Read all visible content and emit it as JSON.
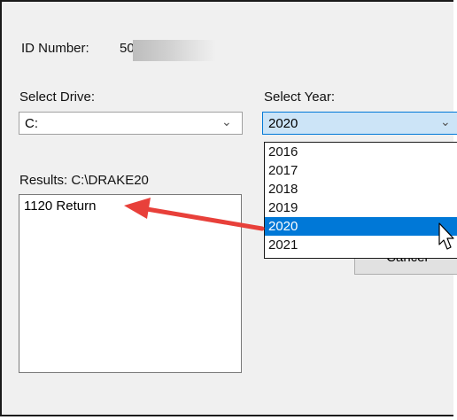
{
  "id_number": {
    "label": "ID Number:",
    "value_visible": "50"
  },
  "drive": {
    "label": "Select Drive:",
    "selected": "C:"
  },
  "year": {
    "label": "Select Year:",
    "selected": "2020",
    "options": [
      "2016",
      "2017",
      "2018",
      "2019",
      "2020",
      "2021"
    ],
    "highlighted_index": 4
  },
  "results": {
    "label": "Results: C:\\DRAKE20",
    "items": [
      "1120 Return"
    ]
  },
  "buttons": {
    "cancel": "Cancel"
  },
  "icons": {
    "dropdown": "chevron-down-icon",
    "cursor": "mouse-pointer-icon",
    "annotation": "red-arrow"
  },
  "colors": {
    "selection": "#0078d7",
    "combo_focus": "#cce4f7",
    "annotation_arrow": "#e8403a"
  }
}
